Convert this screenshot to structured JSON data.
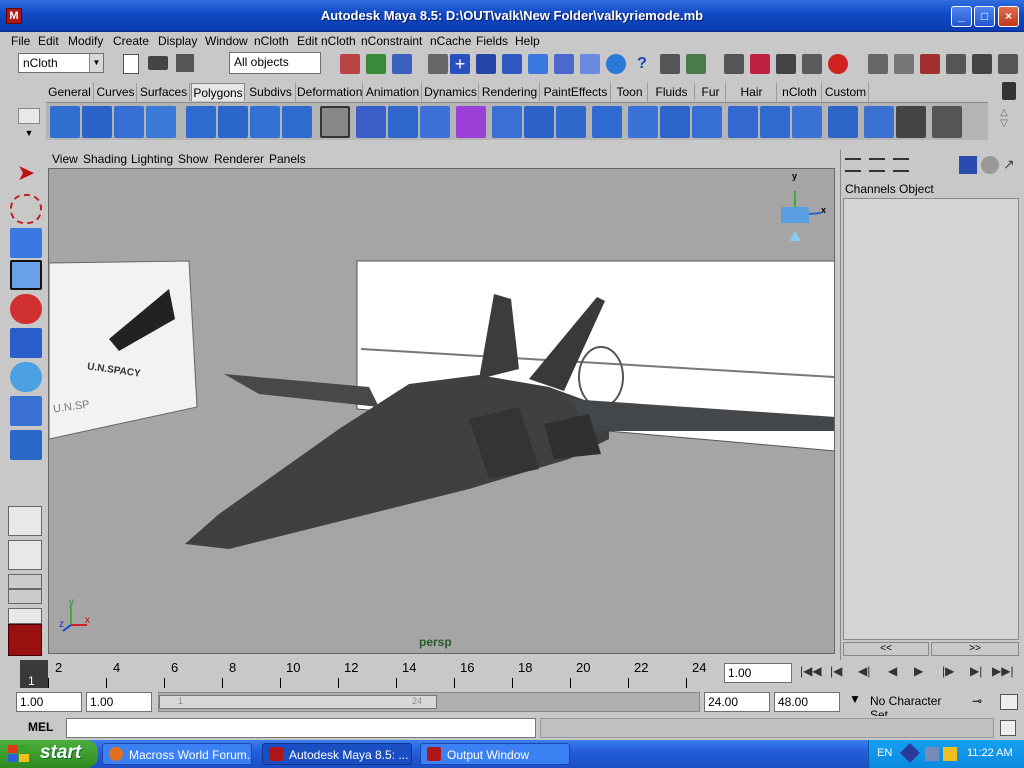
{
  "window": {
    "title": "Autodesk Maya 8.5: D:\\OUT\\valk\\New Folder\\valkyriemode.mb",
    "app_icon": "M",
    "min": "_",
    "max": "□",
    "close": "×"
  },
  "menu": [
    "File",
    "Edit",
    "Modify",
    "Create",
    "Display",
    "Window",
    "nCloth",
    "Edit nCloth",
    "nConstraint",
    "nCache",
    "Fields",
    "Help"
  ],
  "statusline": {
    "menuset": "nCloth",
    "selection_mask": "All objects"
  },
  "shelf_tabs": [
    "General",
    "Curves",
    "Surfaces",
    "Polygons",
    "Subdivs",
    "Deformation",
    "Animation",
    "Dynamics",
    "Rendering",
    "PaintEffects",
    "Toon",
    "Fluids",
    "Fur",
    "Hair",
    "nCloth",
    "Custom"
  ],
  "shelf_active": "Polygons",
  "panel_menu": [
    "View",
    "Shading",
    "Lighting",
    "Show",
    "Renderer",
    "Panels"
  ],
  "viewport": {
    "camera_label": "persp",
    "gizmo": {
      "y": "y",
      "x": "x"
    },
    "axis": {
      "y": "y",
      "x": "x",
      "z": "z"
    },
    "ref_left": {
      "texts": [
        "U.N.SPACY",
        "U.N.SP"
      ]
    }
  },
  "channel_box": {
    "menus": [
      "Channels",
      "Object"
    ],
    "prev": "<<",
    "next": ">>"
  },
  "time_slider": {
    "ticks": [
      "2",
      "4",
      "6",
      "8",
      "10",
      "12",
      "14",
      "16",
      "18",
      "20",
      "22",
      "24"
    ],
    "current": "1",
    "current_field": "1.00"
  },
  "playback": [
    "|◀◀",
    "|◀",
    "◀|",
    "◀",
    "▶",
    "|▶",
    "▶|",
    "▶▶|"
  ],
  "range": {
    "start": "1.00",
    "inner_start": "1.00",
    "range_in": "1",
    "range_out": "24",
    "end": "24.00",
    "outer_end": "48.00",
    "charset": "No Character Set"
  },
  "mel": {
    "label": "MEL"
  },
  "taskbar": {
    "start": "start",
    "tasks": [
      "Macross World Forum...",
      "Autodesk Maya 8.5: ...",
      "Output Window"
    ],
    "lang": "EN",
    "time": "11:22 AM"
  },
  "colors": {
    "titlebar": "#1148c4",
    "viewport": "#a5a5a5",
    "aircraft": "#3e4042",
    "start": "#3a9a2c"
  }
}
